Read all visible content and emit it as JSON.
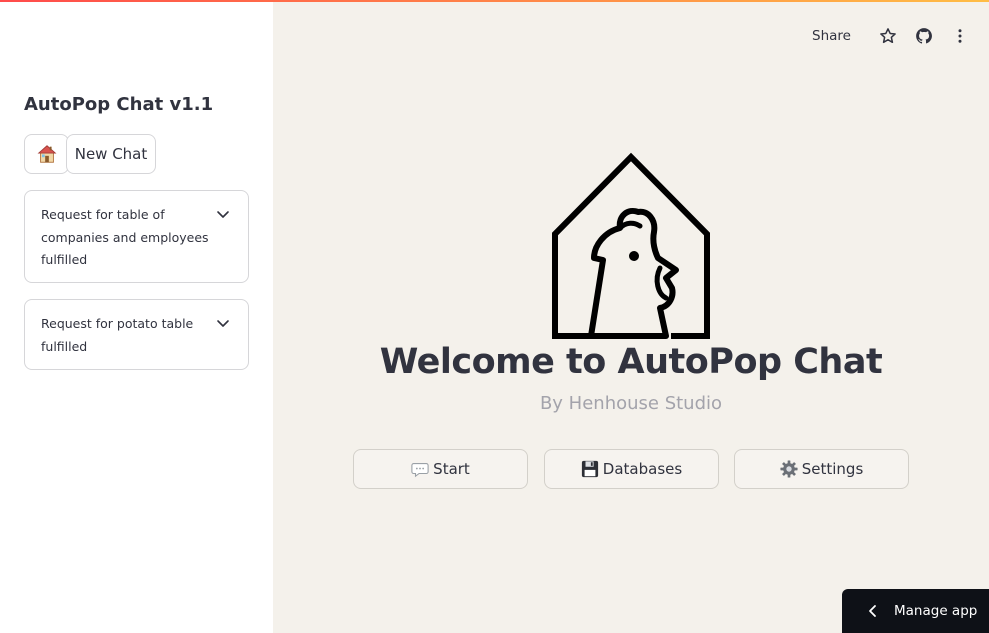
{
  "sidebar": {
    "title": "AutoPop Chat v1.1",
    "home_icon": "house-emoji-icon",
    "new_chat_label": "New Chat",
    "history": [
      {
        "label": "Request for table of companies and employees fulfilled"
      },
      {
        "label": "Request for potato table fulfilled"
      }
    ]
  },
  "toolbar": {
    "share_label": "Share",
    "icons": [
      "star-icon",
      "github-icon",
      "more-vertical-icon"
    ]
  },
  "main": {
    "logo_icon": "henhouse-logo-icon",
    "headline": "Welcome to AutoPop Chat",
    "subtitle": "By Henhouse Studio",
    "buttons": {
      "start": "Start",
      "databases": "Databases",
      "settings": "Settings"
    }
  },
  "manage": {
    "label": "Manage app"
  },
  "colors": {
    "sidebar_bg": "#ffffff",
    "main_bg": "#f4f1eb",
    "text": "#31333f",
    "subtitle": "#a3a3ab",
    "accent_gradient_start": "#ff4b4b",
    "accent_gradient_end": "#ffbd45",
    "manage_bg": "#0e1117"
  }
}
